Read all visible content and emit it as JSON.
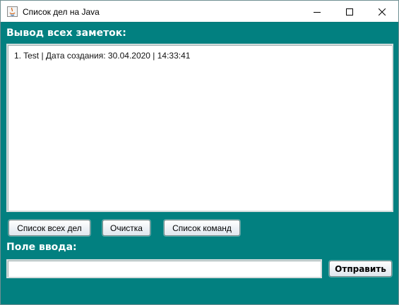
{
  "window": {
    "title": "Список дел на Java",
    "background_color": "#028080",
    "controls": {
      "minimize_icon": "minimize-icon",
      "maximize_icon": "maximize-icon",
      "close_icon": "close-icon"
    }
  },
  "output": {
    "label": "Вывод всех заметок:",
    "lines": [
      "1. Test | Дата создания: 30.04.2020 | 14:33:41"
    ]
  },
  "buttons": {
    "list_all": "Список всех дел",
    "clear": "Очистка",
    "commands": "Список команд",
    "send": "Отправить"
  },
  "input": {
    "label": "Поле ввода:",
    "value": ""
  }
}
